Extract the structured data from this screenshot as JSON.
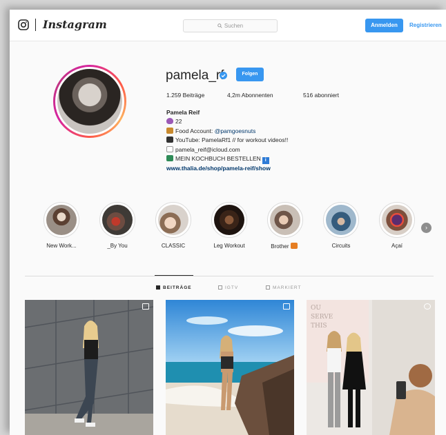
{
  "header": {
    "logo_text": "Instagram",
    "search_placeholder": "Suchen",
    "login_label": "Anmelden",
    "register_label": "Registrieren",
    "accent_color": "#3897f0"
  },
  "profile": {
    "username": "pamela_rf",
    "follow_label": "Folgen",
    "posts": "1.259 Beiträge",
    "followers": "4,2m Abonnenten",
    "following": "516 abonniert",
    "full_name": "Pamela Reif",
    "bio": {
      "line1": "22",
      "line2_prefix": "Food Account: ",
      "line2_tag": "@pamgoesnuts",
      "line3": "YouTube: PamelaRf1 // for workout videos!!",
      "line4": "pamela_reif@icloud.com",
      "line5": "MEIN KOCHBUCH BESTELLEN",
      "info_glyph": "i",
      "website": "www.thalia.de/shop/pamela-reif/show"
    }
  },
  "highlights": [
    {
      "label": "New Work...",
      "icon": "workout-photo"
    },
    {
      "label": "_By You",
      "icon": "food-photo"
    },
    {
      "label": "CLASSIC",
      "icon": "portrait-photo"
    },
    {
      "label": "Leg Workout",
      "icon": "gym-photo"
    },
    {
      "label": "Brother",
      "icon": "people-photo"
    },
    {
      "label": "Circuits",
      "icon": "exercise-photo"
    },
    {
      "label": "Açaí",
      "icon": "bowl-photo"
    }
  ],
  "tabs": [
    {
      "label": "BEITRÄGE",
      "active": true
    },
    {
      "label": "IGTV",
      "active": false
    },
    {
      "label": "MARKIERT",
      "active": false
    }
  ],
  "posts": [
    {
      "icon": "multi-photo-icon"
    },
    {
      "icon": "multi-photo-icon"
    },
    {
      "icon": "video-icon"
    }
  ]
}
